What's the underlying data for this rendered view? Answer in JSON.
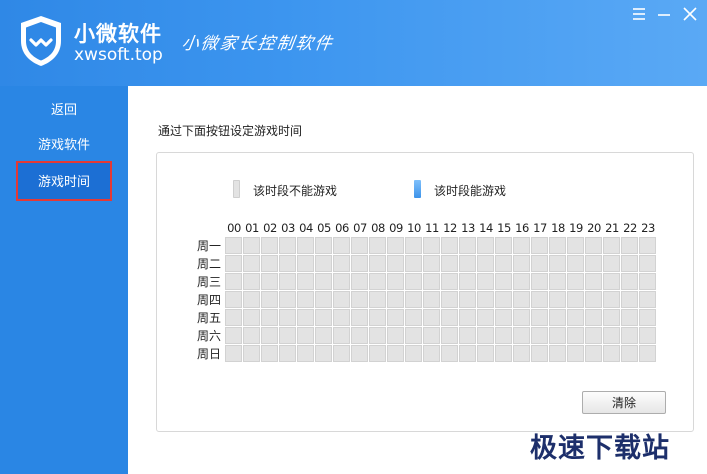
{
  "header": {
    "brand_name": "小微软件",
    "brand_url": "xwsoft.top",
    "slogan": "小微家长控制软件"
  },
  "colors": {
    "header_blue": "#3c95ef",
    "sidebar_blue": "#2a86e4",
    "active_nav": "#1c6fd4",
    "highlight_red": "#e53935",
    "cell_blocked": "#e3e3e3",
    "cell_allowed": "#5aa9f5"
  },
  "sidebar": {
    "items": [
      {
        "label": "返回"
      },
      {
        "label": "游戏软件"
      },
      {
        "label": "游戏时间",
        "active": true
      }
    ]
  },
  "main": {
    "instruction": "通过下面按钮设定游戏时间",
    "legend": {
      "blocked": "该时段不能游戏",
      "allowed": "该时段能游戏"
    },
    "hours": [
      "00",
      "01",
      "02",
      "03",
      "04",
      "05",
      "06",
      "07",
      "08",
      "09",
      "10",
      "11",
      "12",
      "13",
      "14",
      "15",
      "16",
      "17",
      "18",
      "19",
      "20",
      "21",
      "22",
      "23"
    ],
    "days": [
      "周一",
      "周二",
      "周三",
      "周四",
      "周五",
      "周六",
      "周日"
    ],
    "clear_label": "清除"
  },
  "watermark": "极速下载站"
}
